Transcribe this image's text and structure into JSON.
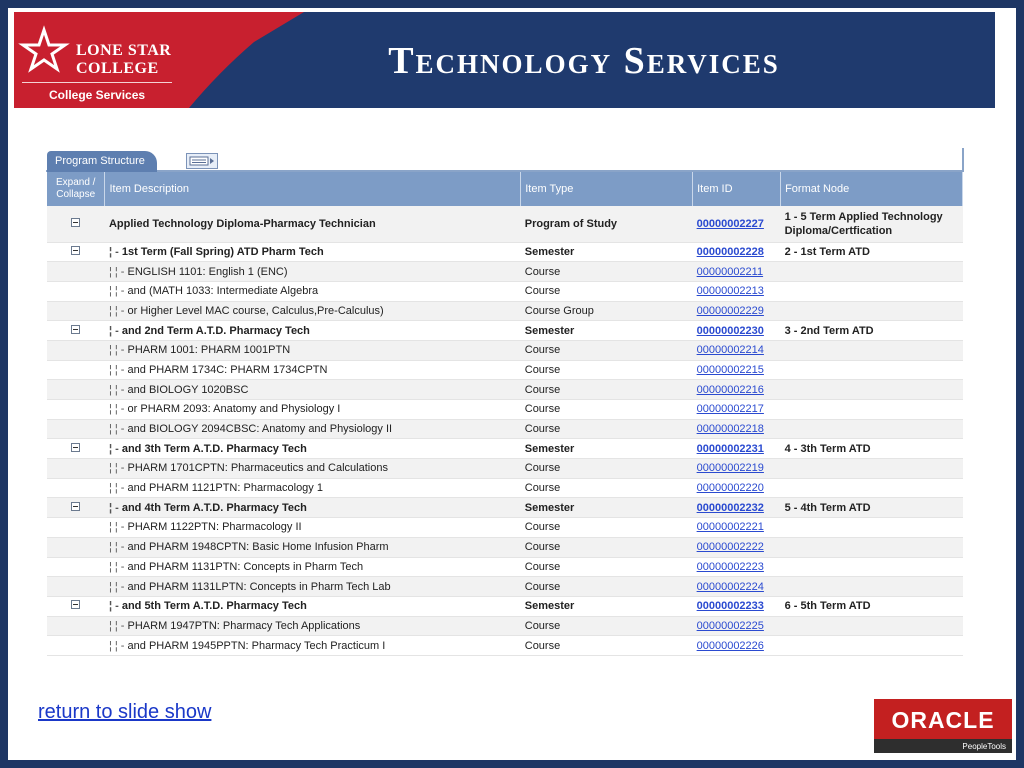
{
  "banner": {
    "logo_line1": "LONE STAR",
    "logo_line2": "COLLEGE",
    "logo_sub": "College Services",
    "title": "Technology Services"
  },
  "tabs": {
    "program_structure": "Program Structure",
    "expand_icon": "view-all-icon"
  },
  "table": {
    "headers": {
      "expand": "Expand / Collapse",
      "desc": "Item Description",
      "type": "Item Type",
      "id": "Item ID",
      "format": "Format Node"
    },
    "rows": [
      {
        "toggle": true,
        "prefix": "",
        "desc": "Applied Technology Diploma-Pharmacy Technician",
        "type": "Program of Study",
        "id": "00000002227",
        "format": "1 - 5 Term Applied Technology Diploma/Certfication",
        "bold": true
      },
      {
        "toggle": true,
        "prefix": "¦ -",
        "desc": "1st Term (Fall Spring) ATD Pharm Tech",
        "type": "Semester",
        "id": "00000002228",
        "format": "2 - 1st Term ATD",
        "bold": true
      },
      {
        "toggle": false,
        "prefix": "¦  ¦ -",
        "desc": "ENGLISH 1101: English 1 (ENC)",
        "type": "Course",
        "id": "00000002211",
        "format": "",
        "bold": false
      },
      {
        "toggle": false,
        "prefix": "¦  ¦ -",
        "desc": "and (MATH 1033: Intermediate Algebra",
        "type": "Course",
        "id": "00000002213",
        "format": "",
        "bold": false
      },
      {
        "toggle": false,
        "prefix": "¦  ¦ -",
        "desc": "or Higher Level MAC course, Calculus,Pre-Calculus)",
        "type": "Course Group",
        "id": "00000002229",
        "format": "",
        "bold": false
      },
      {
        "toggle": true,
        "prefix": "¦ -",
        "desc": "and 2nd Term A.T.D. Pharmacy Tech",
        "type": "Semester",
        "id": "00000002230",
        "format": "3 - 2nd Term ATD",
        "bold": true
      },
      {
        "toggle": false,
        "prefix": "¦  ¦ -",
        "desc": "PHARM 1001: PHARM 1001PTN",
        "type": "Course",
        "id": "00000002214",
        "format": "",
        "bold": false
      },
      {
        "toggle": false,
        "prefix": "¦  ¦ -",
        "desc": "and PHARM 1734C: PHARM 1734CPTN",
        "type": "Course",
        "id": "00000002215",
        "format": "",
        "bold": false
      },
      {
        "toggle": false,
        "prefix": "¦  ¦ -",
        "desc": "and BIOLOGY 1020BSC",
        "type": "Course",
        "id": "00000002216",
        "format": "",
        "bold": false
      },
      {
        "toggle": false,
        "prefix": "¦  ¦ -",
        "desc": "or PHARM 2093: Anatomy and Physiology I",
        "type": "Course",
        "id": "00000002217",
        "format": "",
        "bold": false
      },
      {
        "toggle": false,
        "prefix": "¦  ¦ -",
        "desc": "and BIOLOGY 2094CBSC: Anatomy and Physiology II",
        "type": "Course",
        "id": "00000002218",
        "format": "",
        "bold": false
      },
      {
        "toggle": true,
        "prefix": "¦ -",
        "desc": "and 3th Term A.T.D. Pharmacy Tech",
        "type": "Semester",
        "id": "00000002231",
        "format": "4 - 3th Term ATD",
        "bold": true
      },
      {
        "toggle": false,
        "prefix": "¦  ¦ -",
        "desc": "PHARM 1701CPTN: Pharmaceutics and Calculations",
        "type": "Course",
        "id": "00000002219",
        "format": "",
        "bold": false
      },
      {
        "toggle": false,
        "prefix": "¦  ¦ -",
        "desc": "and PHARM 1121PTN: Pharmacology 1",
        "type": "Course",
        "id": "00000002220",
        "format": "",
        "bold": false
      },
      {
        "toggle": true,
        "prefix": "¦ -",
        "desc": "and 4th Term A.T.D. Pharmacy Tech",
        "type": "Semester",
        "id": "00000002232",
        "format": "5 - 4th Term ATD",
        "bold": true
      },
      {
        "toggle": false,
        "prefix": "¦  ¦ -",
        "desc": "PHARM 1122PTN: Pharmacology II",
        "type": "Course",
        "id": "00000002221",
        "format": "",
        "bold": false
      },
      {
        "toggle": false,
        "prefix": "¦  ¦ -",
        "desc": "and PHARM 1948CPTN: Basic Home Infusion Pharm",
        "type": "Course",
        "id": "00000002222",
        "format": "",
        "bold": false
      },
      {
        "toggle": false,
        "prefix": "¦  ¦ -",
        "desc": "and PHARM 1131PTN: Concepts in Pharm Tech",
        "type": "Course",
        "id": "00000002223",
        "format": "",
        "bold": false
      },
      {
        "toggle": false,
        "prefix": "¦  ¦ -",
        "desc": "and PHARM 1131LPTN: Concepts in Pharm Tech Lab",
        "type": "Course",
        "id": "00000002224",
        "format": "",
        "bold": false
      },
      {
        "toggle": true,
        "prefix": "¦ -",
        "desc": "and 5th Term A.T.D. Pharmacy Tech",
        "type": "Semester",
        "id": "00000002233",
        "format": "6 - 5th Term ATD",
        "bold": true
      },
      {
        "toggle": false,
        "prefix": "¦  ¦ -",
        "desc": "PHARM 1947PTN: Pharmacy Tech Applications",
        "type": "Course",
        "id": "00000002225",
        "format": "",
        "bold": false
      },
      {
        "toggle": false,
        "prefix": "¦  ¦ -",
        "desc": "and PHARM 1945PPTN: Pharmacy Tech Practicum I",
        "type": "Course",
        "id": "00000002226",
        "format": "",
        "bold": false
      }
    ]
  },
  "footer": {
    "return_link": "return to slide show",
    "oracle_text": "ORACLE",
    "oracle_sub": "PeopleTools"
  },
  "colors": {
    "banner": "#1f3a6e",
    "logo_red": "#c8202f",
    "header": "#7d9cc6",
    "link": "#2a4ad0"
  }
}
